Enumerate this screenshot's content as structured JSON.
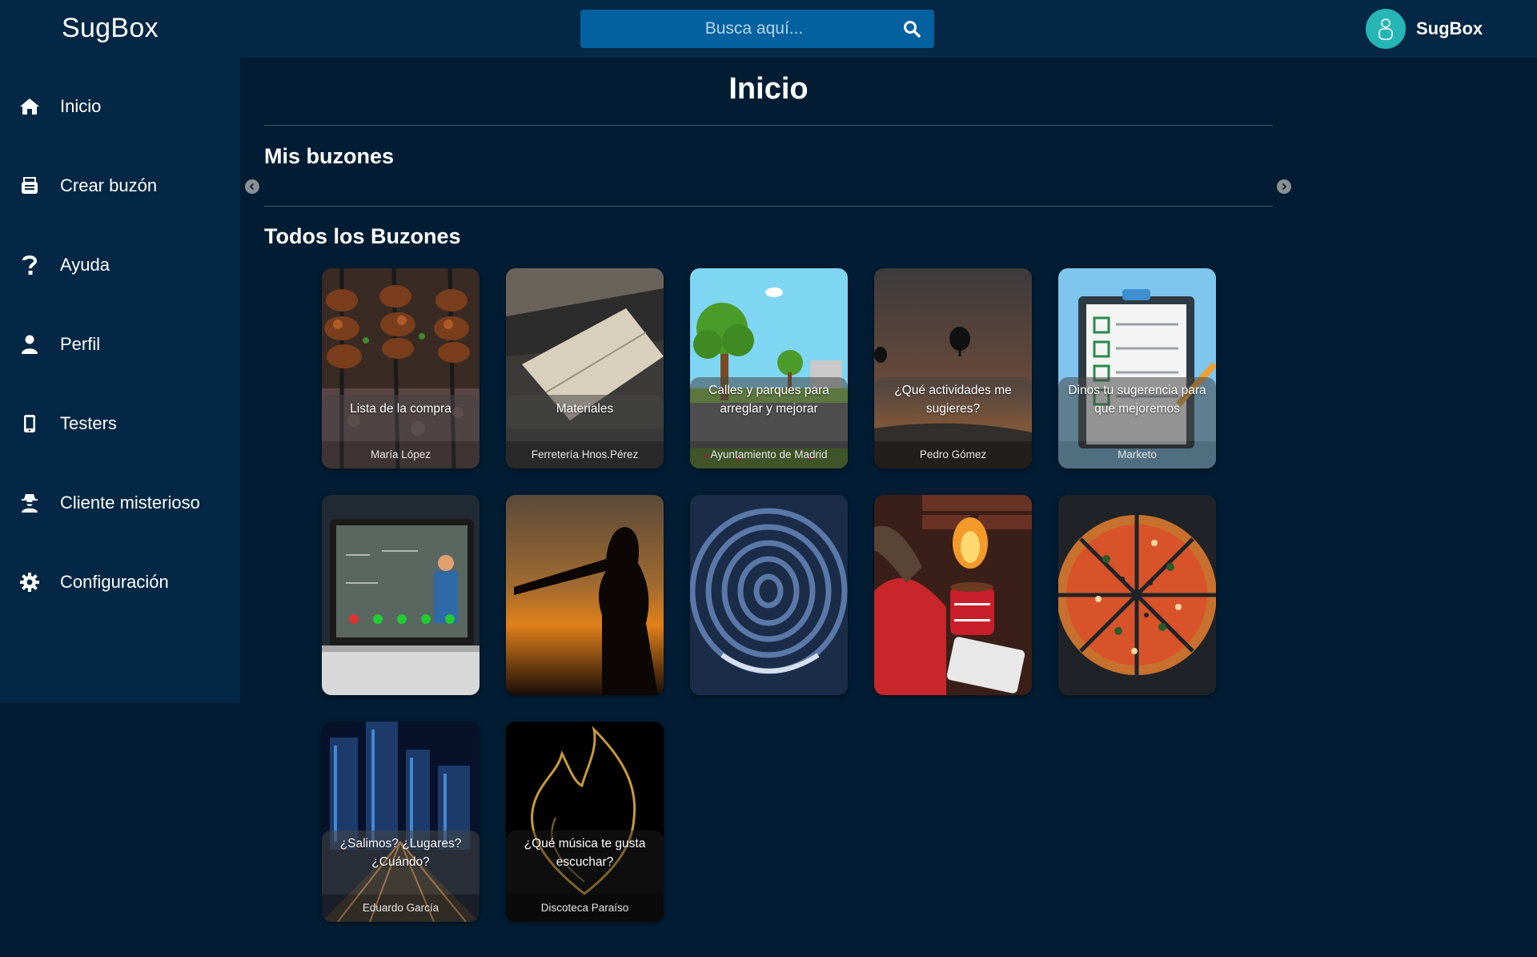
{
  "app": {
    "brand": "SugBox"
  },
  "search": {
    "placeholder": "Busca aquí..."
  },
  "profile": {
    "name": "SugBox"
  },
  "sidebar": {
    "items": [
      {
        "label": "Inicio",
        "icon": "home-icon"
      },
      {
        "label": "Crear buzón",
        "icon": "mailbox-icon"
      },
      {
        "label": "Ayuda",
        "icon": "question-icon"
      },
      {
        "label": "Perfil",
        "icon": "user-icon"
      },
      {
        "label": "Testers",
        "icon": "mobile-icon"
      },
      {
        "label": "Cliente misterioso",
        "icon": "user-secret-icon"
      },
      {
        "label": "Configuración",
        "icon": "gear-icon"
      }
    ]
  },
  "main": {
    "title": "Inicio",
    "my_mailboxes_title": "Mis buzones",
    "all_mailboxes_title": "Todos los Buzones",
    "cards": [
      {
        "title": "Lista de la compra",
        "owner": "María López",
        "image": "barbecue-skewers"
      },
      {
        "title": "Materiales",
        "owner": "Ferretería Hnos.Pérez",
        "image": "notebook-laptop"
      },
      {
        "title": "Calles y parques para arreglar y mejorar",
        "owner": "Ayuntamiento de Madrid",
        "image": "park-illustration"
      },
      {
        "title": "¿Qué actividades me sugieres?",
        "owner": "Pedro Gómez",
        "image": "hot-air-balloons"
      },
      {
        "title": "Dinos tu sugerencia para que mejoremos",
        "owner": "Marketo",
        "image": "checklist-clipboard"
      },
      {
        "title": "",
        "owner": "",
        "image": "online-class-laptop"
      },
      {
        "title": "",
        "owner": "",
        "image": "silhouette-sunset"
      },
      {
        "title": "",
        "owner": "",
        "image": "blue-maze"
      },
      {
        "title": "",
        "owner": "",
        "image": "cozy-fireplace-mug"
      },
      {
        "title": "",
        "owner": "",
        "image": "pizza"
      },
      {
        "title": "¿Salimos? ¿Lugares? ¿Cuándo?",
        "owner": "Eduardo García",
        "image": "city-night"
      },
      {
        "title": "¿Qué música te gusta escuchar?",
        "owner": "Discoteca Paraíso",
        "image": "flame-heart"
      }
    ]
  },
  "colors": {
    "background": "#021d33",
    "bar": "#032744",
    "search": "#04619f",
    "avatar": "#25b5b5"
  }
}
